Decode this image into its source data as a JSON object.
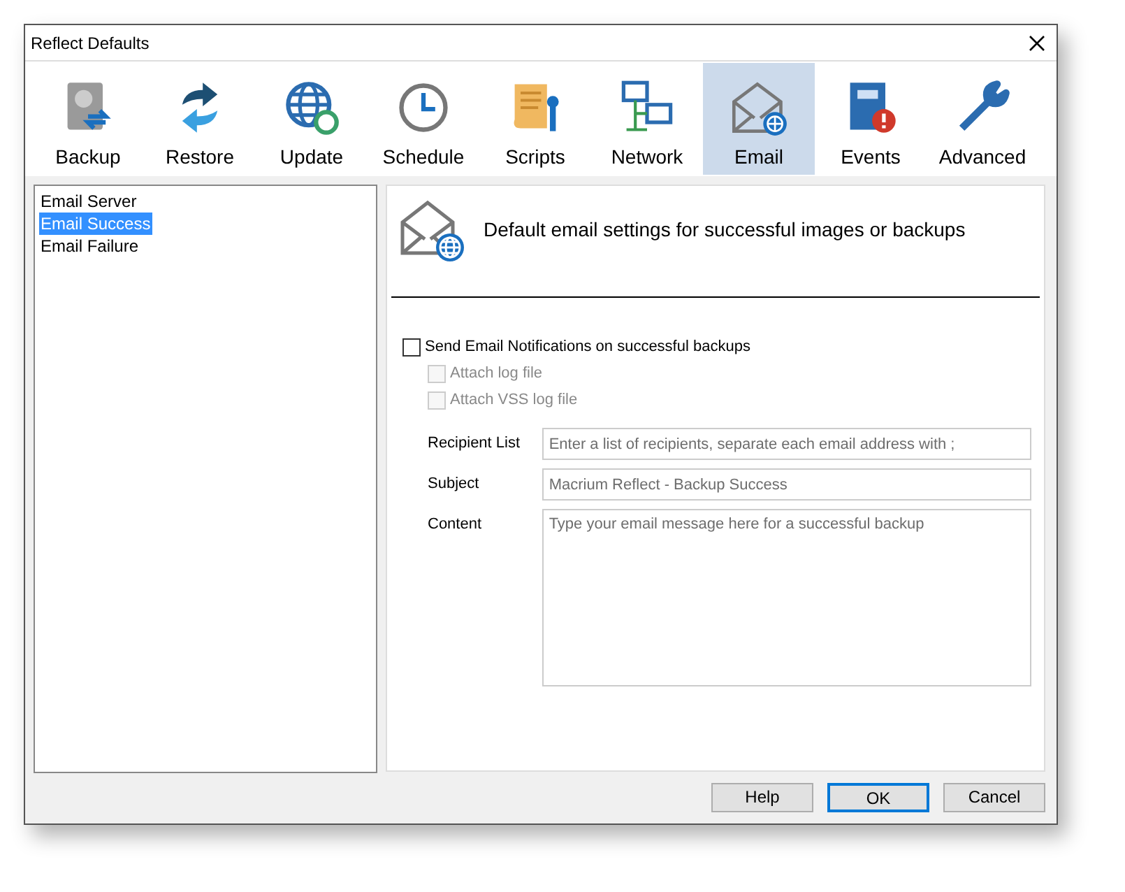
{
  "window": {
    "title": "Reflect Defaults"
  },
  "tabs": [
    {
      "label": "Backup",
      "selected": false
    },
    {
      "label": "Restore",
      "selected": false
    },
    {
      "label": "Update",
      "selected": false
    },
    {
      "label": "Schedule",
      "selected": false
    },
    {
      "label": "Scripts",
      "selected": false
    },
    {
      "label": "Network",
      "selected": false
    },
    {
      "label": "Email",
      "selected": true
    },
    {
      "label": "Events",
      "selected": false
    },
    {
      "label": "Advanced",
      "selected": false
    }
  ],
  "sidebar": {
    "items": [
      {
        "label": "Email Server",
        "selected": false
      },
      {
        "label": "Email Success",
        "selected": true
      },
      {
        "label": "Email Failure",
        "selected": false
      }
    ]
  },
  "panel": {
    "heading": "Default email settings for successful images or backups",
    "options": [
      {
        "label": "Send Email Notifications on successful backups",
        "checked": false,
        "disabled": false,
        "indented": false
      },
      {
        "label": "Attach log file",
        "checked": false,
        "disabled": true,
        "indented": true
      },
      {
        "label": "Attach VSS log file",
        "checked": false,
        "disabled": true,
        "indented": true
      }
    ],
    "fields": [
      {
        "label": "Recipient List",
        "placeholder": "Enter a list of recipients, separate each email address with ;",
        "kind": "line"
      },
      {
        "label": "Subject",
        "value": "Macrium Reflect - Backup Success",
        "kind": "line"
      },
      {
        "label": "Content",
        "placeholder": "Type your email message here for a successful backup",
        "kind": "area"
      }
    ]
  },
  "buttons": [
    {
      "label": "Help",
      "default": false
    },
    {
      "label": "OK",
      "default": true
    },
    {
      "label": "Cancel",
      "default": false
    }
  ]
}
